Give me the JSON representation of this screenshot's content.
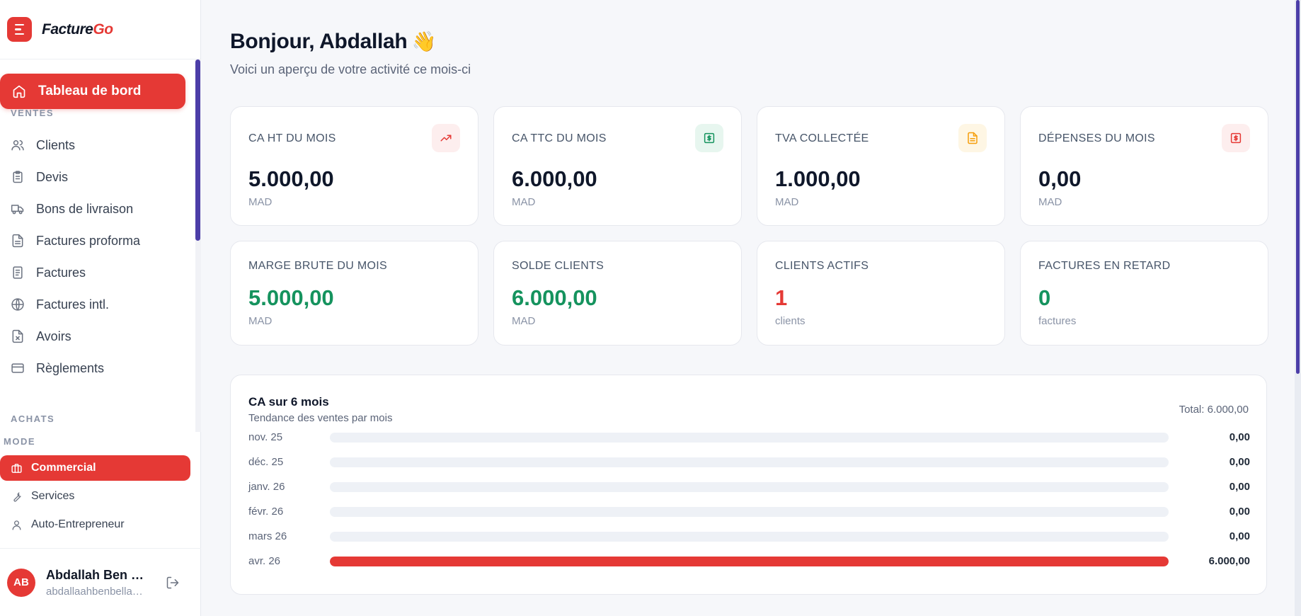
{
  "brand": {
    "name_part1": "Facture",
    "name_part2": "Go"
  },
  "sidebar": {
    "active_item": {
      "label": "Tableau de bord",
      "icon": "home-icon"
    },
    "sections": {
      "ventes": "VENTES",
      "achats": "ACHATS"
    },
    "items": [
      {
        "label": "Clients",
        "icon": "users-icon"
      },
      {
        "label": "Devis",
        "icon": "clipboard-icon"
      },
      {
        "label": "Bons de livraison",
        "icon": "truck-icon"
      },
      {
        "label": "Factures proforma",
        "icon": "file-text-icon"
      },
      {
        "label": "Factures",
        "icon": "receipt-icon"
      },
      {
        "label": "Factures intl.",
        "icon": "globe-icon"
      },
      {
        "label": "Avoirs",
        "icon": "file-x-icon"
      },
      {
        "label": "Règlements",
        "icon": "credit-card-icon"
      }
    ],
    "mode": {
      "label": "MODE",
      "options": [
        {
          "label": "Commercial",
          "icon": "briefcase-icon",
          "active": true
        },
        {
          "label": "Services",
          "icon": "wrench-icon",
          "active": false
        },
        {
          "label": "Auto-Entrepreneur",
          "icon": "user-icon",
          "active": false
        }
      ]
    },
    "user": {
      "initials": "AB",
      "name": "Abdallah Ben Bella",
      "email": "abdallaahbenbella@gmail.com"
    }
  },
  "header": {
    "greeting": "Bonjour, Abdallah",
    "wave": "👋",
    "subtitle": "Voici un aperçu de votre activité ce mois-ci"
  },
  "stats_row1": [
    {
      "label": "CA HT DU MOIS",
      "value": "5.000,00",
      "unit": "MAD",
      "icon": "trending-up-icon",
      "icon_color": "#e53935",
      "badge_bg": "#fdeeee"
    },
    {
      "label": "CA TTC DU MOIS",
      "value": "6.000,00",
      "unit": "MAD",
      "icon": "dollar-square-icon",
      "icon_color": "#15935e",
      "badge_bg": "#e7f6ef"
    },
    {
      "label": "TVA COLLECTÉE",
      "value": "1.000,00",
      "unit": "MAD",
      "icon": "file-icon",
      "icon_color": "#f59e0b",
      "badge_bg": "#fef6e4"
    },
    {
      "label": "DÉPENSES DU MOIS",
      "value": "0,00",
      "unit": "MAD",
      "icon": "dollar-square-icon",
      "icon_color": "#e53935",
      "badge_bg": "#fdeeee"
    }
  ],
  "stats_row2": [
    {
      "label": "MARGE BRUTE DU MOIS",
      "value": "5.000,00",
      "unit": "MAD",
      "color": "green"
    },
    {
      "label": "SOLDE CLIENTS",
      "value": "6.000,00",
      "unit": "MAD",
      "color": "green"
    },
    {
      "label": "CLIENTS ACTIFS",
      "value": "1",
      "unit": "clients",
      "color": "red"
    },
    {
      "label": "FACTURES EN RETARD",
      "value": "0",
      "unit": "factures",
      "color": "green"
    }
  ],
  "revenue_chart": {
    "title": "CA sur 6 mois",
    "subtitle": "Tendance des ventes par mois",
    "total": "Total: 6.000,00",
    "bar_color": "#e53935",
    "max_value": 6000,
    "months": [
      {
        "label": "nov. 25",
        "amount": 0,
        "display": "0,00"
      },
      {
        "label": "déc. 25",
        "amount": 0,
        "display": "0,00"
      },
      {
        "label": "janv. 26",
        "amount": 0,
        "display": "0,00"
      },
      {
        "label": "févr. 26",
        "amount": 0,
        "display": "0,00"
      },
      {
        "label": "mars 26",
        "amount": 0,
        "display": "0,00"
      },
      {
        "label": "avr. 26",
        "amount": 6000,
        "display": "6.000,00"
      }
    ]
  }
}
